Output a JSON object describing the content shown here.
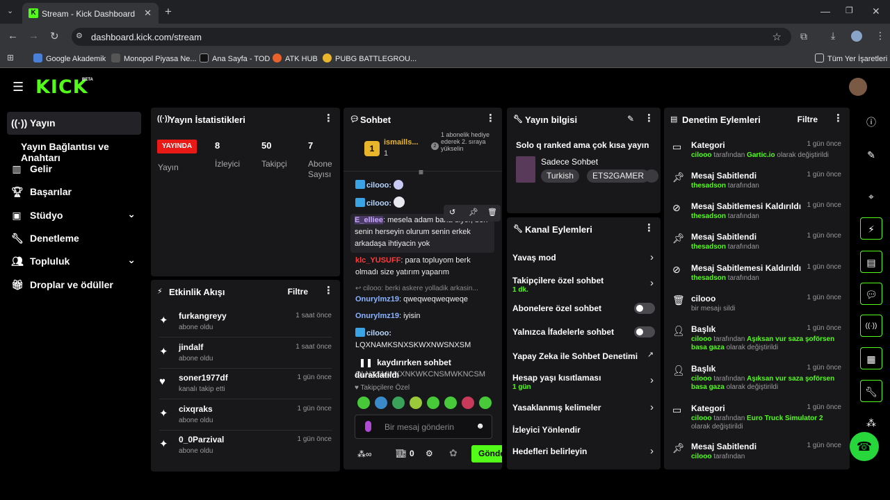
{
  "browser": {
    "tab_title": "Stream - Kick Dashboard",
    "url": "dashboard.kick.com/stream",
    "bookmarks": [
      "Google Akademik",
      "Monopol Piyasa Ne...",
      "Ana Sayfa - TOD",
      "ATK HUB",
      "PUBG BATTLEGROU..."
    ],
    "all_bookmarks": "Tüm Yer İşaretleri"
  },
  "app": {
    "logo": "KICK",
    "beta": "BETA"
  },
  "sidebar": {
    "items": [
      {
        "label": "Yayın",
        "icon": "broadcast-icon"
      },
      {
        "label": "Yayın Bağlantısı ve Anahtarı"
      },
      {
        "label": "Gelir",
        "icon": "chart-icon"
      },
      {
        "label": "Başarılar",
        "icon": "trophy-icon"
      },
      {
        "label": "Stüdyo",
        "icon": "studio-icon"
      },
      {
        "label": "Denetleme",
        "icon": "wrench-icon"
      },
      {
        "label": "Topluluk",
        "icon": "people-icon"
      },
      {
        "label": "Droplar ve ödüller",
        "icon": "gift-icon"
      }
    ]
  },
  "stats": {
    "title": "Yayın İstatistikleri",
    "live_badge": "YAYINDA",
    "live_label": "Yayın",
    "viewers": "8",
    "viewers_label": "İzleyici",
    "followers": "50",
    "followers_label": "Takipçi",
    "subs": "7",
    "subs_label": "Abone Sayısı"
  },
  "activity": {
    "title": "Etkinlik Akışı",
    "filter": "Filtre",
    "items": [
      {
        "user": "furkangreyy",
        "desc": "abone oldu",
        "time": "1 saat önce",
        "icon": "sparkle-icon"
      },
      {
        "user": "jindalf",
        "desc": "abone oldu",
        "time": "1 saat önce",
        "icon": "sparkle-icon"
      },
      {
        "user": "soner1977df",
        "desc": "kanalı takip etti",
        "time": "1 gün önce",
        "icon": "heart-icon"
      },
      {
        "user": "cixqraks",
        "desc": "abone oldu",
        "time": "1 gün önce",
        "icon": "sparkle-icon"
      },
      {
        "user": "0_0Parzival",
        "desc": "abone oldu",
        "time": "1 gün önce",
        "icon": "sparkle-icon"
      }
    ]
  },
  "chat": {
    "title": "Sohbet",
    "top_user": "ismaills...",
    "top_count": "1",
    "rank_text": "1 abonelik hediye ederek 2. sıraya yükselin",
    "messages": [
      {
        "user": "cilooo:",
        "text": ""
      },
      {
        "user": "cilooo:",
        "text": ""
      },
      {
        "user": "E_elliee",
        "text": ": mesela adam bana diyor, ben senin herseyin olurum senin erkek arkadaşa ihtiyacin yok"
      },
      {
        "user": "klc_YUSUFF",
        "text": ": para topluyom berk olmadı size yatırım yaparım"
      },
      {
        "user": "",
        "text": "cilooo: berki askere yolladik arkasin..."
      },
      {
        "user": "Onurylmz19",
        "text": ": qweqweqweqweqe"
      },
      {
        "user": "Onurylmz19",
        "text": ": iyisin"
      },
      {
        "user": "cilooo:",
        "text": "LQXNAMKSNXSKWXNWSNXSM"
      },
      {
        "user": "",
        "text": "QLNXSMWKXNKWKCNSMWKNCSM"
      }
    ],
    "paused": "kaydırırken sohbet duraklatıldı",
    "followers_only": "Takipçilere Özel",
    "placeholder": "Bir mesaj gönderin",
    "points": "0",
    "send": "Gönder"
  },
  "streaminfo": {
    "title": "Yayın bilgisi",
    "stream_title": "Solo q ranked ama çok kısa yayın",
    "category": "Sadece Sohbet",
    "tags": [
      "Turkish",
      "ETS2GAMER"
    ]
  },
  "channel": {
    "title": "Kanal Eylemleri",
    "items": [
      {
        "label": "Yavaş mod",
        "sub": "",
        "control": "chevron"
      },
      {
        "label": "Takipçilere özel sohbet",
        "sub": "1 dk.",
        "control": "chevron"
      },
      {
        "label": "Abonelere özel sohbet",
        "sub": "",
        "control": "toggle"
      },
      {
        "label": "Yalnızca İfadelerle sohbet",
        "sub": "",
        "control": "toggle"
      },
      {
        "label": "Yapay Zeka ile Sohbet Denetimi",
        "sub": "",
        "control": "external"
      },
      {
        "label": "Hesap yaşı kısıtlaması",
        "sub": "1 gün",
        "control": "chevron"
      },
      {
        "label": "Yasaklanmış kelimeler",
        "sub": "",
        "control": "chevron"
      },
      {
        "label": "İzleyici Yönlendir",
        "sub": "",
        "control": "none"
      },
      {
        "label": "Hedefleri belirleyin",
        "sub": "",
        "control": "chevron"
      }
    ]
  },
  "modlog": {
    "title": "Denetim Eylemleri",
    "filter": "Filtre",
    "items": [
      {
        "action": "Kategori",
        "time": "1 gün önce",
        "icon": "category-icon",
        "user": "cilooo",
        "mid": " tarafından ",
        "bold": "Gartic.io",
        "end": " olarak değiştirildi"
      },
      {
        "action": "Mesaj Sabitlendi",
        "time": "1 gün önce",
        "icon": "pin-icon",
        "user": "thesadson",
        "mid": " tarafından",
        "bold": "",
        "end": ""
      },
      {
        "action": "Mesaj Sabitlemesi Kaldırıldı",
        "time": "1 gün önce",
        "icon": "unpin-icon",
        "user": "thesadson",
        "mid": " tarafından",
        "bold": "",
        "end": ""
      },
      {
        "action": "Mesaj Sabitlendi",
        "time": "1 gün önce",
        "icon": "pin-icon",
        "user": "thesadson",
        "mid": " tarafından",
        "bold": "",
        "end": ""
      },
      {
        "action": "Mesaj Sabitlemesi Kaldırıldı",
        "time": "1 gün önce",
        "icon": "unpin-icon",
        "user": "thesadson",
        "mid": " tarafından",
        "bold": "",
        "end": ""
      },
      {
        "action": "cilooo",
        "time": "1 gün önce",
        "icon": "trash-icon",
        "user": "",
        "mid": "bir mesajı sildi",
        "bold": "",
        "end": ""
      },
      {
        "action": "Başlık",
        "time": "1 gün önce",
        "icon": "title-icon",
        "user": "cilooo",
        "mid": " tarafından ",
        "bold": "Aşıksan vur saza şoförsen basa gaza",
        "end": " olarak değiştirildi"
      },
      {
        "action": "Başlık",
        "time": "1 gün önce",
        "icon": "title-icon",
        "user": "cilooo",
        "mid": " tarafından ",
        "bold": "Aşıksan vur saza şoförsen basa gaza",
        "end": " olarak değiştirildi"
      },
      {
        "action": "Kategori",
        "time": "1 gün önce",
        "icon": "category-icon",
        "user": "cilooo",
        "mid": " tarafından ",
        "bold": "Euro Truck Simulator 2",
        "end": " olarak değiştirildi"
      },
      {
        "action": "Mesaj Sabitlendi",
        "time": "1 gün önce",
        "icon": "pin-icon",
        "user": "cilooo",
        "mid": " tarafından",
        "bold": "",
        "end": ""
      }
    ]
  },
  "colors": {
    "accent": "#53fc18",
    "live": "#e91916",
    "panel": "#18181b"
  }
}
